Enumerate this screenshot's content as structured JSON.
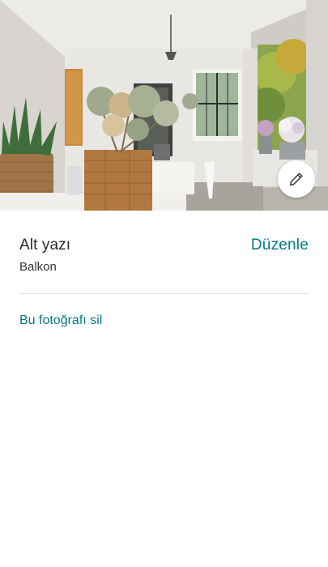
{
  "photo": {
    "edit_icon": "pencil-icon"
  },
  "caption": {
    "label": "Alt yazı",
    "edit_label": "Düzenle",
    "value": "Balkon"
  },
  "actions": {
    "delete_label": "Bu fotoğrafı sil"
  },
  "colors": {
    "accent": "#007a87",
    "text": "#2a2a2a",
    "divider": "#e6e6e6"
  }
}
